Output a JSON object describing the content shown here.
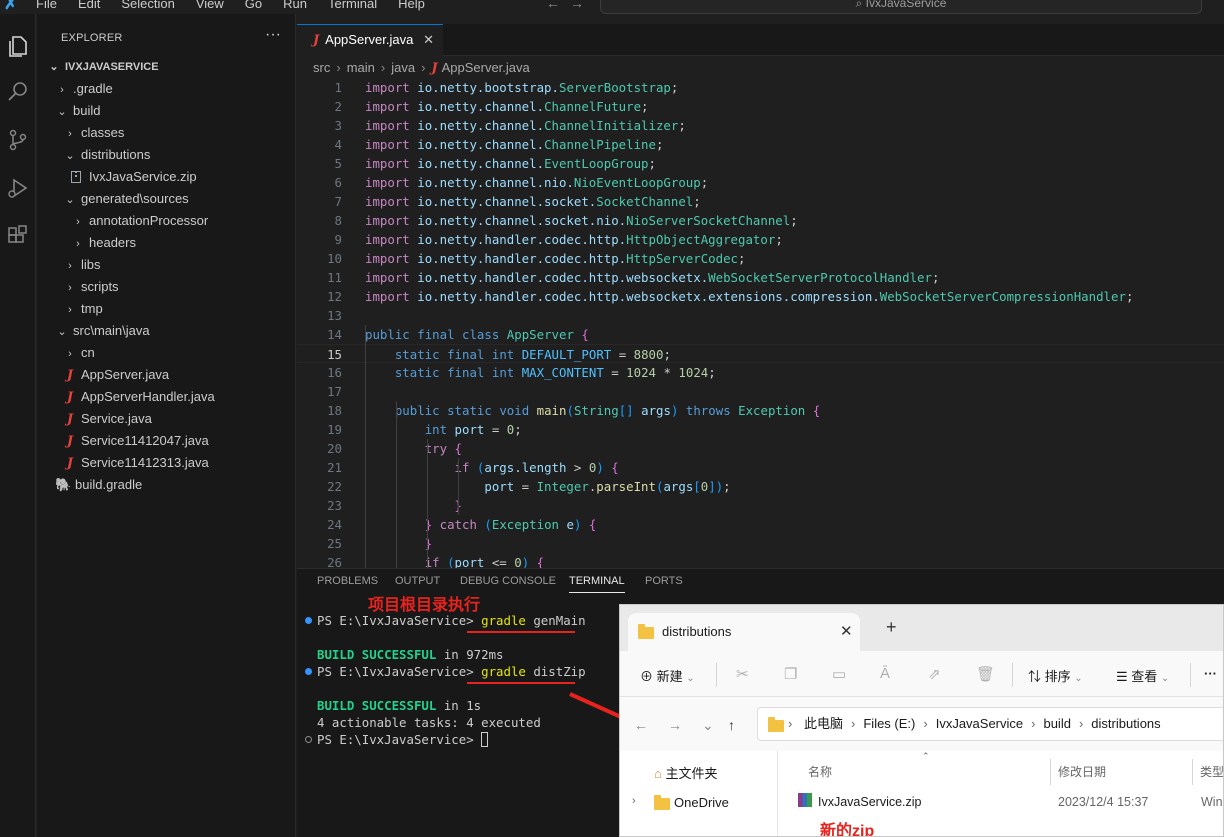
{
  "menu": [
    "File",
    "Edit",
    "Selection",
    "View",
    "Go",
    "Run",
    "Terminal",
    "Help"
  ],
  "search_text": "IvxJavaService",
  "explorer": {
    "header": "EXPLORER",
    "more": "···",
    "tree": [
      {
        "label": "IVXJAVASERVICE",
        "chev": "⌄",
        "depth": 0,
        "kind": "root"
      },
      {
        "label": ".gradle",
        "chev": "›",
        "depth": 1,
        "kind": "folder"
      },
      {
        "label": "build",
        "chev": "⌄",
        "depth": 1,
        "kind": "folder"
      },
      {
        "label": "classes",
        "chev": "›",
        "depth": 2,
        "kind": "folder"
      },
      {
        "label": "distributions",
        "chev": "⌄",
        "depth": 2,
        "kind": "folder"
      },
      {
        "label": "IvxJavaService.zip",
        "chev": "",
        "depth": 3,
        "kind": "zip"
      },
      {
        "label": "generated\\sources",
        "chev": "⌄",
        "depth": 2,
        "kind": "folder"
      },
      {
        "label": "annotationProcessor",
        "chev": "›",
        "depth": 3,
        "kind": "folder"
      },
      {
        "label": "headers",
        "chev": "›",
        "depth": 3,
        "kind": "folder"
      },
      {
        "label": "libs",
        "chev": "›",
        "depth": 2,
        "kind": "folder"
      },
      {
        "label": "scripts",
        "chev": "›",
        "depth": 2,
        "kind": "folder"
      },
      {
        "label": "tmp",
        "chev": "›",
        "depth": 2,
        "kind": "folder"
      },
      {
        "label": "src\\main\\java",
        "chev": "⌄",
        "depth": 1,
        "kind": "folder"
      },
      {
        "label": "cn",
        "chev": "›",
        "depth": 2,
        "kind": "folder"
      },
      {
        "label": "AppServer.java",
        "chev": "",
        "depth": 2,
        "kind": "java"
      },
      {
        "label": "AppServerHandler.java",
        "chev": "",
        "depth": 2,
        "kind": "java"
      },
      {
        "label": "Service.java",
        "chev": "",
        "depth": 2,
        "kind": "java"
      },
      {
        "label": "Service11412047.java",
        "chev": "",
        "depth": 2,
        "kind": "java"
      },
      {
        "label": "Service11412313.java",
        "chev": "",
        "depth": 2,
        "kind": "java"
      },
      {
        "label": "build.gradle",
        "chev": "",
        "depth": 1,
        "kind": "gradle"
      }
    ]
  },
  "editor": {
    "tab": "AppServer.java",
    "breadcrumb": [
      "src",
      "main",
      "java",
      "AppServer.java"
    ],
    "current_line": 15,
    "lines": [
      "import io.netty.bootstrap.ServerBootstrap;",
      "import io.netty.channel.ChannelFuture;",
      "import io.netty.channel.ChannelInitializer;",
      "import io.netty.channel.ChannelPipeline;",
      "import io.netty.channel.EventLoopGroup;",
      "import io.netty.channel.nio.NioEventLoopGroup;",
      "import io.netty.channel.socket.SocketChannel;",
      "import io.netty.channel.socket.nio.NioServerSocketChannel;",
      "import io.netty.handler.codec.http.HttpObjectAggregator;",
      "import io.netty.handler.codec.http.HttpServerCodec;",
      "import io.netty.handler.codec.http.websocketx.WebSocketServerProtocolHandler;",
      "import io.netty.handler.codec.http.websocketx.extensions.compression.WebSocketServerCompressionHandler;",
      "",
      "public final class AppServer {",
      "    static final int DEFAULT_PORT = 8800;",
      "    static final int MAX_CONTENT = 1024 * 1024;",
      "",
      "    public static void main(String[] args) throws Exception {",
      "        int port = 0;",
      "        try {",
      "            if (args.length > 0) {",
      "                port = Integer.parseInt(args[0]);",
      "            }",
      "        } catch (Exception e) {",
      "        }",
      "        if (port <= 0) {"
    ]
  },
  "panel": {
    "tabs": [
      "PROBLEMS",
      "OUTPUT",
      "DEBUG CONSOLE",
      "TERMINAL",
      "PORTS"
    ],
    "active_tab": "TERMINAL",
    "terminal": {
      "prompt": "PS E:\\IvxJavaService> ",
      "cmd1_kw": "gradle",
      "cmd1_arg": " genMain",
      "build_ok": "BUILD SUCCESSFUL",
      "time1": " in 972ms",
      "cmd2_kw": "gradle",
      "cmd2_arg": " distZip",
      "time2": " in 1s",
      "tasks": "4 actionable tasks: 4 executed"
    },
    "annotation_root": "项目根目录执行"
  },
  "file_explorer": {
    "tab_title": "distributions",
    "toolbar": {
      "new": "新建",
      "sort": "排序",
      "view": "查看",
      "more": "···"
    },
    "path": [
      "此电脑",
      "Files (E:)",
      "IvxJavaService",
      "build",
      "distributions"
    ],
    "nav_items": [
      "主文件夹",
      "OneDrive"
    ],
    "columns": [
      "名称",
      "修改日期",
      "类型"
    ],
    "file": {
      "name": "IvxJavaService.zip",
      "modified": "2023/12/4 15:37",
      "type": "Win"
    },
    "annotation_new_zip": "新的zip"
  }
}
